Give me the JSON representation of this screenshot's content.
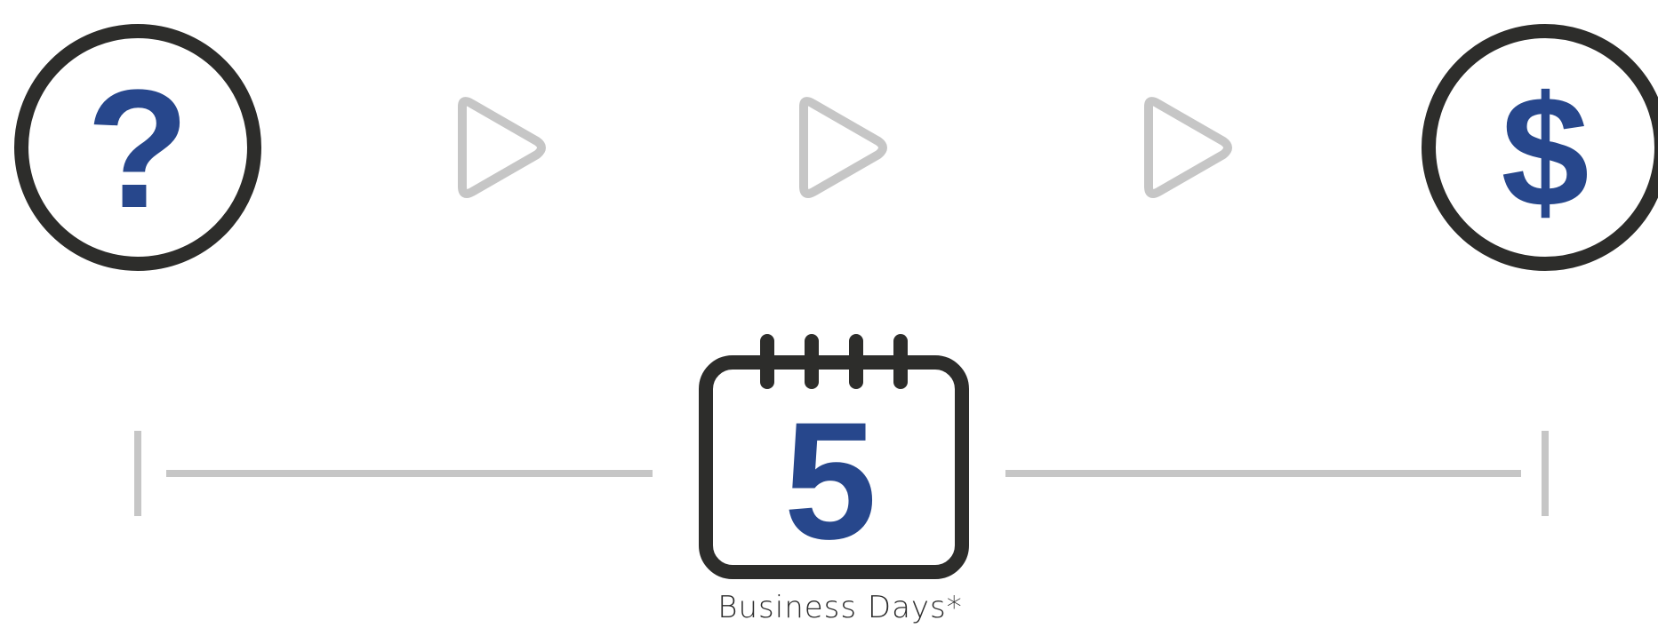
{
  "start": {
    "symbol": "?",
    "icon": "question-icon"
  },
  "end": {
    "symbol": "$",
    "icon": "dollar-icon"
  },
  "arrows": [
    {
      "icon": "play-arrow-icon"
    },
    {
      "icon": "play-arrow-icon"
    },
    {
      "icon": "play-arrow-icon"
    }
  ],
  "calendar": {
    "icon": "calendar-icon",
    "number": "5"
  },
  "caption": "Business Days*",
  "colors": {
    "ring": "#2d2d2b",
    "accent": "#27478c",
    "muted": "#c6c6c6"
  }
}
